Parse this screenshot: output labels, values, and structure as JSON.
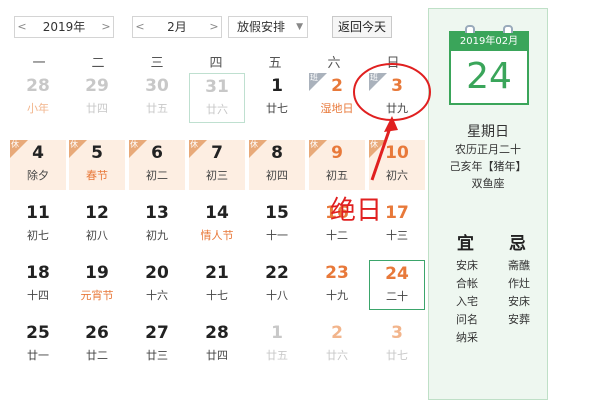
{
  "toolbar": {
    "year_value": "2019年",
    "month_value": "2月",
    "holiday_select": "放假安排",
    "today_button": "返回今天"
  },
  "weekdays": [
    "一",
    "二",
    "三",
    "四",
    "五",
    "六",
    "日"
  ],
  "rows": [
    [
      {
        "num": "28",
        "sub": "小年",
        "dim": true,
        "subRed": true
      },
      {
        "num": "29",
        "sub": "廿四",
        "dim": true
      },
      {
        "num": "30",
        "sub": "廿五",
        "dim": true
      },
      {
        "num": "31",
        "sub": "廿六",
        "dim": true,
        "hl": true
      },
      {
        "num": "1",
        "sub": "廿七"
      },
      {
        "num": "2",
        "sub": "湿地日",
        "numRed": true,
        "subRed": true,
        "badge": "班"
      },
      {
        "num": "3",
        "sub": "廿九",
        "numRed": true,
        "badge": "班"
      }
    ],
    [
      {
        "num": "4",
        "sub": "除夕",
        "rest": true,
        "badge": "休"
      },
      {
        "num": "5",
        "sub": "春节",
        "rest": true,
        "badge": "休",
        "subRed": true
      },
      {
        "num": "6",
        "sub": "初二",
        "rest": true,
        "badge": "休"
      },
      {
        "num": "7",
        "sub": "初三",
        "rest": true,
        "badge": "休"
      },
      {
        "num": "8",
        "sub": "初四",
        "rest": true,
        "badge": "休"
      },
      {
        "num": "9",
        "sub": "初五",
        "rest": true,
        "badge": "休",
        "numRed": true
      },
      {
        "num": "10",
        "sub": "初六",
        "rest": true,
        "badge": "休",
        "numRed": true
      }
    ],
    [
      {
        "num": "11",
        "sub": "初七"
      },
      {
        "num": "12",
        "sub": "初八"
      },
      {
        "num": "13",
        "sub": "初九"
      },
      {
        "num": "14",
        "sub": "情人节",
        "subRed": true
      },
      {
        "num": "15",
        "sub": "十一"
      },
      {
        "num": "16",
        "sub": "十二",
        "numRed": true
      },
      {
        "num": "17",
        "sub": "十三",
        "numRed": true
      }
    ],
    [
      {
        "num": "18",
        "sub": "十四"
      },
      {
        "num": "19",
        "sub": "元宵节",
        "subRed": true
      },
      {
        "num": "20",
        "sub": "十六"
      },
      {
        "num": "21",
        "sub": "十七"
      },
      {
        "num": "22",
        "sub": "十八"
      },
      {
        "num": "23",
        "sub": "十九",
        "numRed": true
      },
      {
        "num": "24",
        "sub": "二十",
        "numRed": true,
        "today": true
      }
    ],
    [
      {
        "num": "25",
        "sub": "廿一"
      },
      {
        "num": "26",
        "sub": "廿二"
      },
      {
        "num": "27",
        "sub": "廿三"
      },
      {
        "num": "28",
        "sub": "廿四"
      },
      {
        "num": "1",
        "sub": "廿五",
        "dim": true
      },
      {
        "num": "2",
        "sub": "廿六",
        "dim": true,
        "numRed": true
      },
      {
        "num": "3",
        "sub": "廿七",
        "dim": true,
        "numRed": true
      }
    ]
  ],
  "side": {
    "header": "2019年02月",
    "day": "24",
    "weekday": "星期日",
    "lunar": "农历正月二十",
    "ganzhi": "己亥年【猪年】",
    "zodiac": "双鱼座",
    "yi_title": "宜",
    "ji_title": "忌",
    "yi": [
      "安床",
      "合帐",
      "入宅",
      "问名",
      "纳采"
    ],
    "ji": [
      "斋醮",
      "作灶",
      "安床",
      "安葬"
    ]
  },
  "annotation": "绝日",
  "colors": {
    "accent": "#3aa55a",
    "holiday": "#e8793a",
    "rest_bg": "#fdeee2",
    "annot": "#e02020"
  }
}
